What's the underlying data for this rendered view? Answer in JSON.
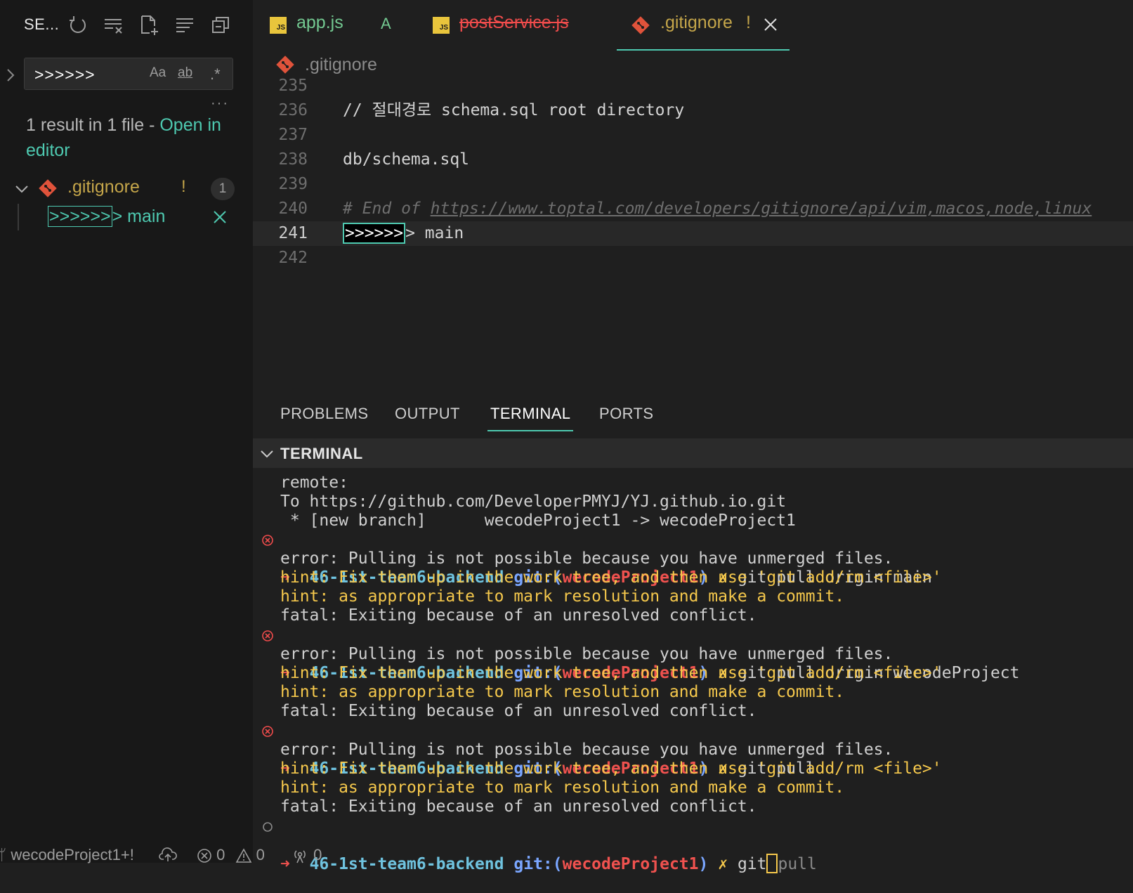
{
  "sidebar": {
    "title": "SE...",
    "actions": [
      "refresh-icon",
      "clear-results-icon",
      "new-search-editor-icon",
      "collapse-all-icon",
      "view-as-tree-icon"
    ],
    "search": {
      "value": ">>>>>>",
      "options": {
        "match_case": "Aa",
        "whole_word": "ab",
        "regex": ".*"
      }
    },
    "more": "···",
    "summary_text": "1 result in 1 file - ",
    "summary_link": "Open in editor",
    "file": {
      "name": ".gitignore",
      "status": "!",
      "count": "1"
    },
    "match": {
      "highlight": ">>>>>>",
      "rest": "> main"
    }
  },
  "tabs": [
    {
      "label": "app.js",
      "badge": "A",
      "icon": "js-file-icon",
      "style": "added"
    },
    {
      "label": "postService.js",
      "icon": "js-file-icon",
      "style": "deleted"
    },
    {
      "label": ".gitignore",
      "badge": "!",
      "icon": "git-file-icon",
      "style": "active"
    }
  ],
  "breadcrumb": {
    "file": ".gitignore"
  },
  "editor": {
    "lines": [
      {
        "num": "235",
        "text": ""
      },
      {
        "num": "236",
        "text": "// 절대경로 schema.sql root directory"
      },
      {
        "num": "237",
        "text": ""
      },
      {
        "num": "238",
        "text": "db/schema.sql"
      },
      {
        "num": "239",
        "text": ""
      },
      {
        "num": "240",
        "comment_prefix": "# End of ",
        "url": "https://www.toptal.com/developers/gitignore/api/vim,macos,node,linux"
      },
      {
        "num": "241",
        "sel": ">>>>>>",
        "rest": "> main",
        "current": true
      },
      {
        "num": "242",
        "text": ""
      }
    ]
  },
  "panel": {
    "tabs": [
      "PROBLEMS",
      "OUTPUT",
      "TERMINAL",
      "PORTS"
    ],
    "active_tab": "TERMINAL",
    "terminal_title": "TERMINAL"
  },
  "terminal": {
    "line_remote": "remote:",
    "line_to": "To https://github.com/DeveloperPMYJ/YJ.github.io.git",
    "line_branch": " * [new branch]      wecodeProject1 -> wecodeProject1",
    "prompt": {
      "arrow": "➜",
      "dir": "46-1st-team6-backend",
      "git": "git:(",
      "branch": "wecodeProject1",
      "close": ")",
      "dirty": "✗"
    },
    "cmd1": "git pull origin main",
    "cmd2": "git pull origin wecodeProject",
    "cmd3": "git pull",
    "cmd4_typed": "git",
    "cmd4_ghost": "pull",
    "error": "error: Pulling is not possible because you have unmerged files.",
    "hint1": "hint: Fix them up in the work tree, and then use 'git add/rm <file>'",
    "hint2": "hint: as appropriate to mark resolution and make a commit.",
    "fatal": "fatal: Exiting because of an unresolved conflict."
  },
  "statusbar": {
    "branch": "wecodeProject1+!",
    "errors": "0",
    "warnings": "0",
    "ports": "0"
  },
  "colors": {
    "accent": "#4ec9b0",
    "git_orange": "#e0533b",
    "modified": "#c5a64a",
    "deleted": "#f14c4c",
    "added": "#73c991",
    "js_yellow": "#e9c53c"
  }
}
